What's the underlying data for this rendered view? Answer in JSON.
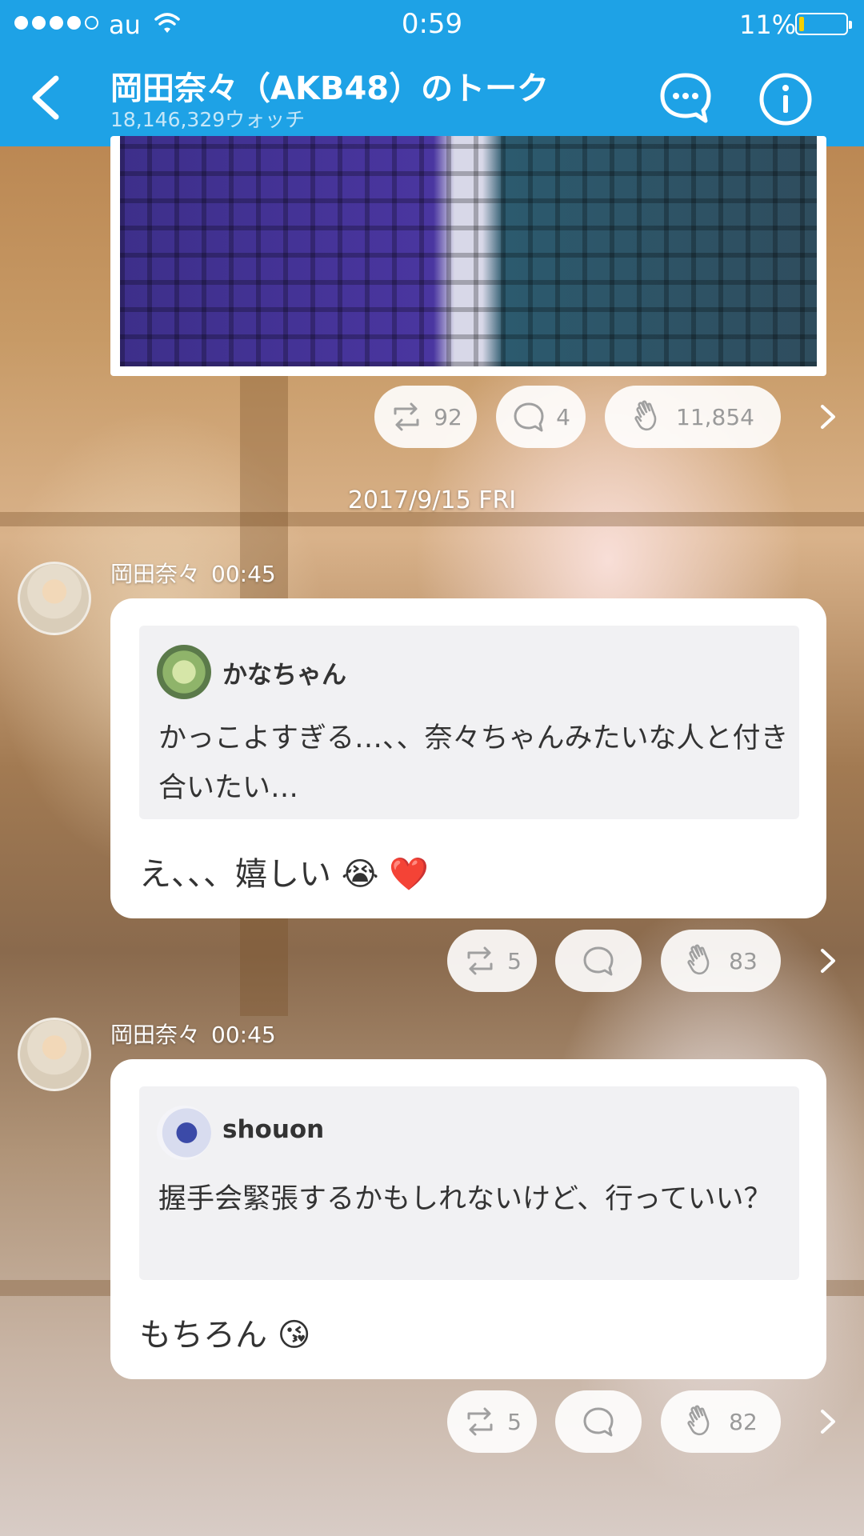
{
  "status_bar": {
    "carrier": "au",
    "time": "0:59",
    "battery": "11%",
    "battery_level": 0.11
  },
  "header": {
    "title": "岡田奈々（AKB48）のトーク",
    "subtitle": "18,146,329ウォッチ"
  },
  "photo_post": {
    "actions": {
      "retalk": "92",
      "comment": "4",
      "clap": "11,854"
    }
  },
  "date_separator": "2017/9/15 FRI",
  "messages": [
    {
      "sender": "岡田奈々",
      "time": "00:45",
      "quote": {
        "name": "かなちゃん",
        "text": "かっこよすぎる…、、奈々ちゃんみたいな人と付き合いたい…"
      },
      "reply": "え、、、嬉しい 😭 ❤️",
      "actions": {
        "retalk": "5",
        "comment": "",
        "clap": "83"
      }
    },
    {
      "sender": "岡田奈々",
      "time": "00:45",
      "quote": {
        "name": "shouon",
        "text": "握手会緊張するかもしれないけど、行っていい？"
      },
      "reply": "もちろん 😘",
      "actions": {
        "retalk": "5",
        "comment": "",
        "clap": "82"
      }
    }
  ]
}
